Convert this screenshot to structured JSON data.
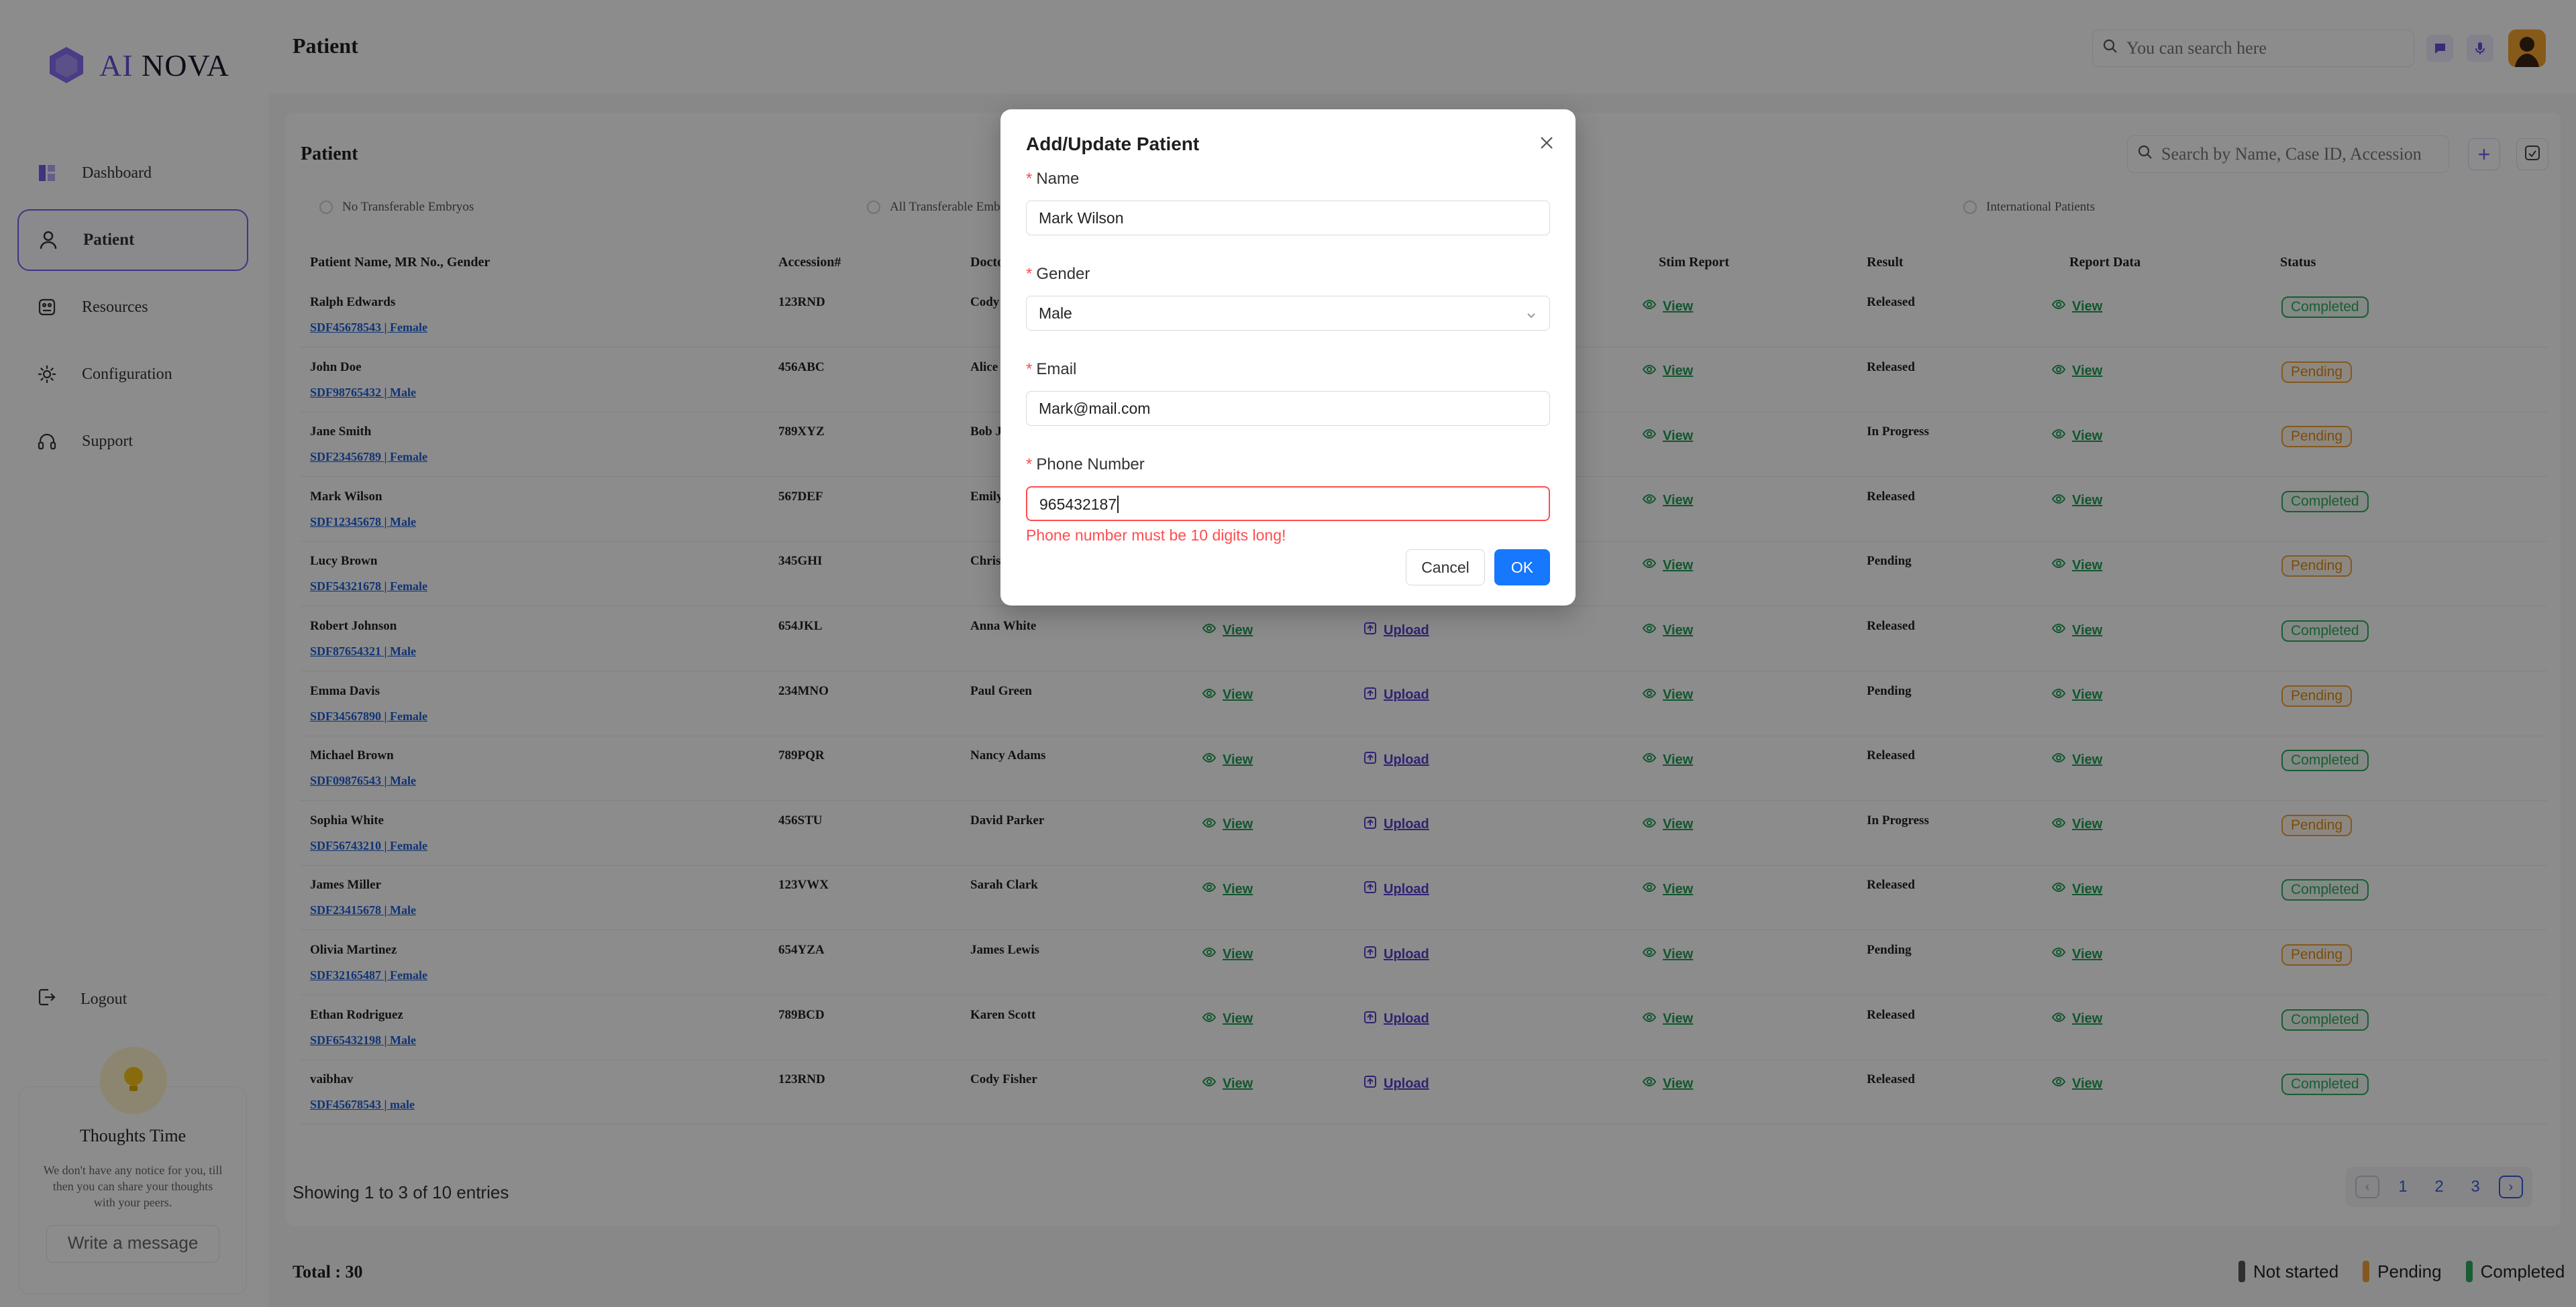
{
  "brand": {
    "prefix": "AI",
    "name": "NOVA"
  },
  "sidebar": {
    "items": [
      {
        "label": "Dashboard",
        "icon": "dashboard-icon"
      },
      {
        "label": "Patient",
        "icon": "user-icon"
      },
      {
        "label": "Resources",
        "icon": "resources-icon"
      },
      {
        "label": "Configuration",
        "icon": "gear-icon"
      },
      {
        "label": "Support",
        "icon": "headset-icon"
      }
    ],
    "logout_label": "Logout",
    "thoughts": {
      "title": "Thoughts Time",
      "description": "We don't have any notice for you, till then you can share your thoughts with your peers.",
      "input_placeholder": "Write a message"
    }
  },
  "header": {
    "title": "Patient",
    "search_placeholder": "You can search here"
  },
  "card": {
    "title": "Patient",
    "search_placeholder": "Search by Name, Case ID, Accession",
    "add_label": "+",
    "filters": [
      "No Transferable Embryos",
      "All Transferable Emb",
      "International Patients"
    ],
    "columns": [
      "Patient Name, MR No., Gender",
      "Accession#",
      "Docto",
      "Stim Report",
      "Result",
      "Report Data",
      "Status"
    ],
    "view_label": "View",
    "upload_label": "Upload",
    "rows": [
      {
        "name": "Ralph Edwards",
        "mr": "SDF45678543 | Female",
        "accession": "123RND",
        "doctor": "Cody",
        "result": "Released",
        "status": "Completed"
      },
      {
        "name": "John Doe",
        "mr": "SDF98765432 | Male",
        "accession": "456ABC",
        "doctor": "Alice",
        "result": "Released",
        "status": "Pending"
      },
      {
        "name": "Jane Smith",
        "mr": "SDF23456789 | Female",
        "accession": "789XYZ",
        "doctor": "Bob J",
        "result": "In Progress",
        "status": "Pending"
      },
      {
        "name": "Mark Wilson",
        "mr": "SDF12345678 | Male",
        "accession": "567DEF",
        "doctor": "Emily",
        "result": "Released",
        "status": "Completed"
      },
      {
        "name": "Lucy Brown",
        "mr": "SDF54321678 | Female",
        "accession": "345GHI",
        "doctor": "Chris",
        "result": "Pending",
        "status": "Pending"
      },
      {
        "name": "Robert Johnson",
        "mr": "SDF87654321 | Male",
        "accession": "654JKL",
        "doctor": "Anna White",
        "result": "Released",
        "status": "Completed"
      },
      {
        "name": "Emma Davis",
        "mr": "SDF34567890 | Female",
        "accession": "234MNO",
        "doctor": "Paul Green",
        "result": "Pending",
        "status": "Pending"
      },
      {
        "name": "Michael Brown",
        "mr": "SDF09876543 | Male",
        "accession": "789PQR",
        "doctor": "Nancy Adams",
        "result": "Released",
        "status": "Completed"
      },
      {
        "name": "Sophia White",
        "mr": "SDF56743210 | Female",
        "accession": "456STU",
        "doctor": "David Parker",
        "result": "In Progress",
        "status": "Pending"
      },
      {
        "name": "James Miller",
        "mr": "SDF23415678 | Male",
        "accession": "123VWX",
        "doctor": "Sarah Clark",
        "result": "Released",
        "status": "Completed"
      },
      {
        "name": "Olivia Martinez",
        "mr": "SDF32165487 | Female",
        "accession": "654YZA",
        "doctor": "James Lewis",
        "result": "Pending",
        "status": "Pending"
      },
      {
        "name": "Ethan Rodriguez",
        "mr": "SDF65432198 | Male",
        "accession": "789BCD",
        "doctor": "Karen Scott",
        "result": "Released",
        "status": "Completed"
      },
      {
        "name": "vaibhav",
        "mr": "SDF45678543 | male",
        "accession": "123RND",
        "doctor": "Cody Fisher",
        "result": "Released",
        "status": "Completed"
      }
    ],
    "entries_text": "Showing 1 to 3 of 10 entries",
    "pages": [
      "1",
      "2",
      "3"
    ]
  },
  "footer": {
    "total": "Total : 30",
    "legend": [
      {
        "label": "Not started",
        "color": "#555555"
      },
      {
        "label": "Pending",
        "color": "#f0a13a"
      },
      {
        "label": "Completed",
        "color": "#2eaa5c"
      }
    ]
  },
  "modal": {
    "title": "Add/Update Patient",
    "name_label": "Name",
    "name_value": "Mark Wilson",
    "gender_label": "Gender",
    "gender_value": "Male",
    "email_label": "Email",
    "email_value": "Mark@mail.com",
    "phone_label": "Phone Number",
    "phone_value": "965432187",
    "phone_error": "Phone number must be 10 digits long!",
    "cancel_label": "Cancel",
    "ok_label": "OK"
  },
  "colors": {
    "accent": "#7a5cf0",
    "primary": "#1677ff",
    "error": "#ff4d4f"
  }
}
